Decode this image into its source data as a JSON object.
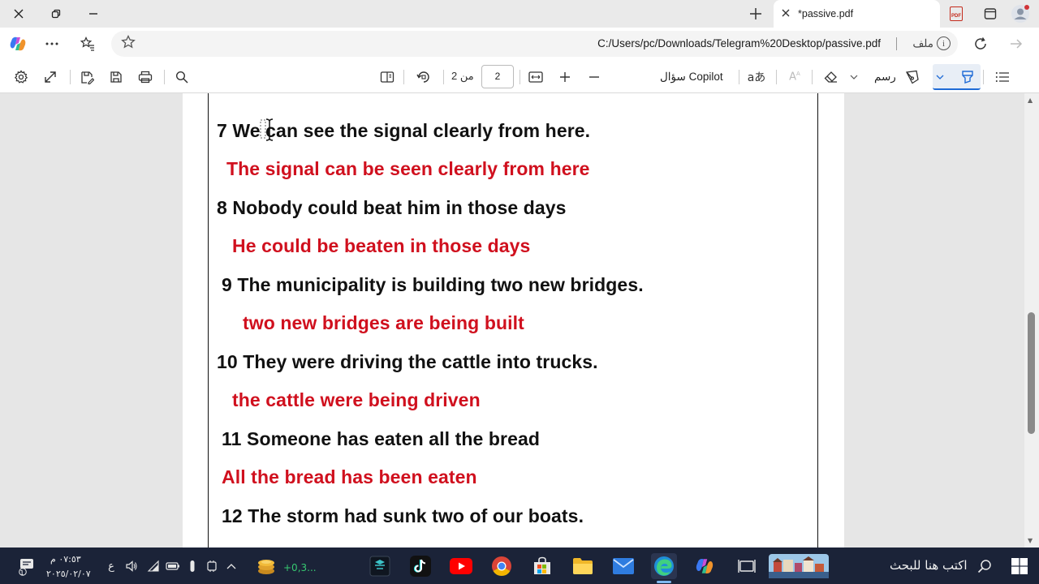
{
  "tab": {
    "title": "*passive.pdf"
  },
  "address": {
    "url": "C:/Users/pc/Downloads/Telegram%20Desktop/passive.pdf",
    "file_label": "ملف"
  },
  "pdf_toolbar": {
    "page_of": "من 2",
    "page_current": "2",
    "ask_copilot": "سؤال Copilot",
    "draw": "رسم"
  },
  "document": {
    "lines": [
      {
        "text": "7 We can see the signal clearly from here.",
        "kind": "question"
      },
      {
        "text": "The signal can be seen clearly from here",
        "kind": "answer"
      },
      {
        "text": "8 Nobody could beat him in those days",
        "kind": "question"
      },
      {
        "text": "He could be beaten in those days",
        "kind": "answer"
      },
      {
        "text": "9 The municipality is building two new bridges.",
        "kind": "question"
      },
      {
        "text": "two new bridges are being built",
        "kind": "answer"
      },
      {
        "text": "10 They were driving the cattle into trucks.",
        "kind": "question"
      },
      {
        "text": "the cattle were being driven",
        "kind": "answer"
      },
      {
        "text": "11 Someone has eaten all the bread",
        "kind": "question"
      },
      {
        "text": "All the bread has been eaten",
        "kind": "answer"
      },
      {
        "text": "12 The storm had sunk two of our boats.",
        "kind": "question"
      }
    ],
    "colors": {
      "question": "#111111",
      "answer": "#d0101e"
    }
  },
  "taskbar": {
    "search_placeholder": "اكتب هنا للبحث",
    "weather_text": "+0,3...",
    "clock_time": "٠٧:٥٣ م",
    "clock_date": "٢٠٢٥/٠٢/٠٧",
    "language": "ع",
    "notification_count": "1"
  }
}
